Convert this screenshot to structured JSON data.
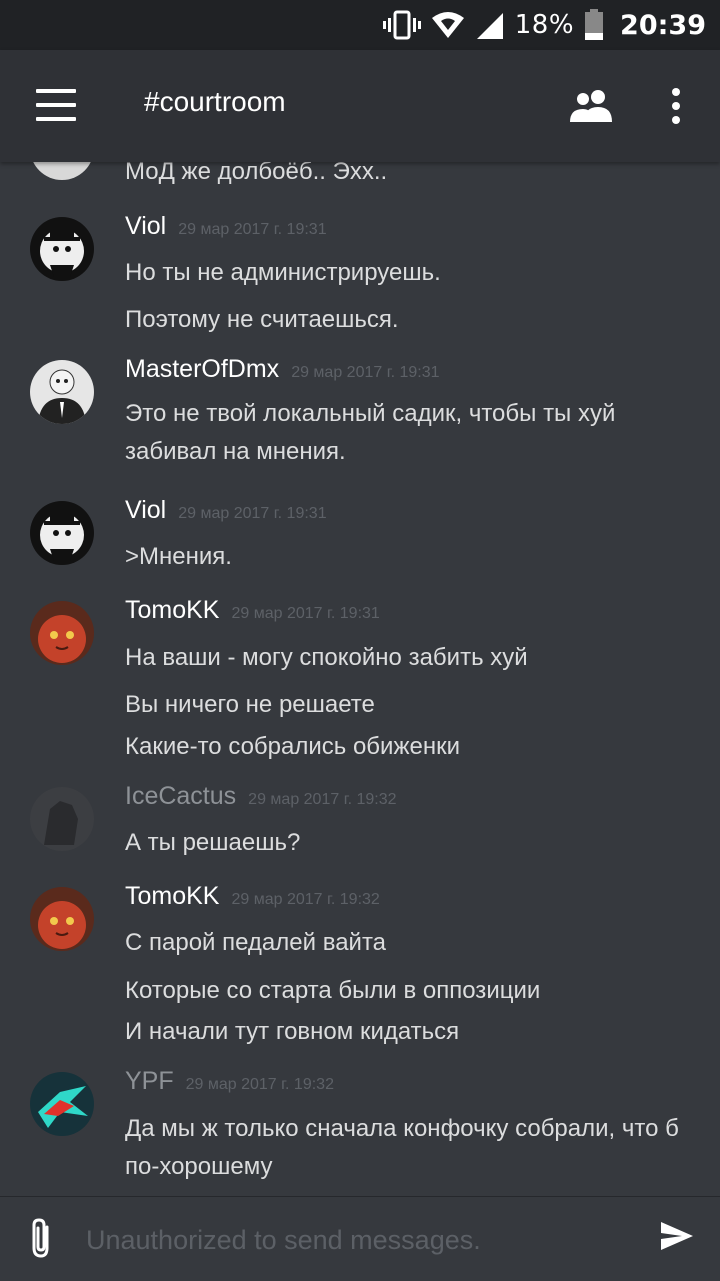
{
  "status_bar": {
    "battery_percent": "18%",
    "time": "20:39"
  },
  "app_bar": {
    "channel": "#courtroom"
  },
  "messages": [
    {
      "author": "",
      "timestamp": "",
      "lines": [
        "МоД же долбоёб.. Эхх.."
      ]
    },
    {
      "author": "Viol",
      "timestamp": "29 мар 2017 г. 19:31",
      "lines": [
        "Но ты не администрируешь.",
        "Поэтому не считаешься."
      ]
    },
    {
      "author": "MasterOfDmx",
      "timestamp": "29 мар 2017 г. 19:31",
      "lines": [
        "Это не твой локальный садик, чтобы ты хуй забивал на мнения."
      ]
    },
    {
      "author": "Viol",
      "timestamp": "29 мар 2017 г. 19:31",
      "lines": [
        ">Мнения."
      ]
    },
    {
      "author": "TomoKK",
      "timestamp": "29 мар 2017 г. 19:31",
      "lines": [
        "На ваши - могу спокойно забить хуй",
        "Вы ничего не решаете",
        "Какие-то собрались обиженки"
      ]
    },
    {
      "author": "IceCactus",
      "timestamp": "29 мар 2017 г. 19:32",
      "lines": [
        "А ты решаешь?"
      ]
    },
    {
      "author": "TomoKK",
      "timestamp": "29 мар 2017 г. 19:32",
      "lines": [
        "С парой педалей вайта",
        "Которые со старта были в оппозиции",
        "И начали тут говном кидаться"
      ]
    },
    {
      "author": "YPF",
      "timestamp": "29 мар 2017 г. 19:32",
      "lines": [
        "Да мы ж только сначала конфочку собрали, что б по-хорошему"
      ]
    }
  ],
  "input": {
    "placeholder": "Unauthorized to send messages."
  },
  "colors": {
    "background": "#36393e",
    "header": "#2f3136",
    "status_bar": "#202225",
    "author_dim": "#8e9297"
  }
}
